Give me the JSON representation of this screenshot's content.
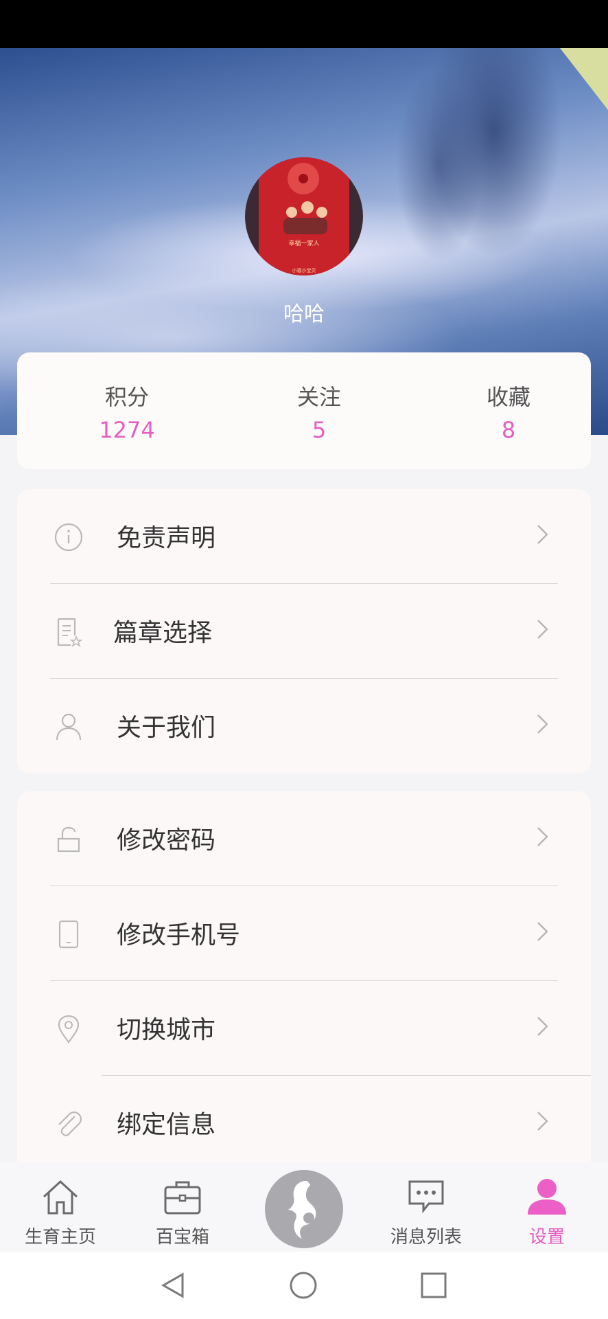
{
  "profile": {
    "username": "哈哈",
    "avatar_envelope_text": "幸福一家人",
    "avatar_bottom_text": "小福小宝贝"
  },
  "stats": [
    {
      "label": "积分",
      "value": "1274"
    },
    {
      "label": "关注",
      "value": "5"
    },
    {
      "label": "收藏",
      "value": "8"
    }
  ],
  "menu_group_1": [
    {
      "label": "免责声明",
      "icon": "info-icon"
    },
    {
      "label": "篇章选择",
      "icon": "document-star-icon"
    },
    {
      "label": "关于我们",
      "icon": "person-icon"
    }
  ],
  "menu_group_2": [
    {
      "label": "修改密码",
      "icon": "lock-icon"
    },
    {
      "label": "修改手机号",
      "icon": "phone-icon"
    },
    {
      "label": "切换城市",
      "icon": "location-pin-icon"
    },
    {
      "label": "绑定信息",
      "icon": "paperclip-icon"
    }
  ],
  "tabbar": {
    "items": [
      {
        "label": "生育主页",
        "icon": "home-icon"
      },
      {
        "label": "百宝箱",
        "icon": "briefcase-icon"
      },
      {
        "label": "",
        "icon": "mother-baby-icon"
      },
      {
        "label": "消息列表",
        "icon": "chat-bubble-icon"
      },
      {
        "label": "设置",
        "icon": "user-icon"
      }
    ],
    "active_index": 4
  },
  "colors": {
    "accent": "#e45fc0",
    "card_bg": "#fcf8f8",
    "page_bg": "#f4f4f6"
  }
}
